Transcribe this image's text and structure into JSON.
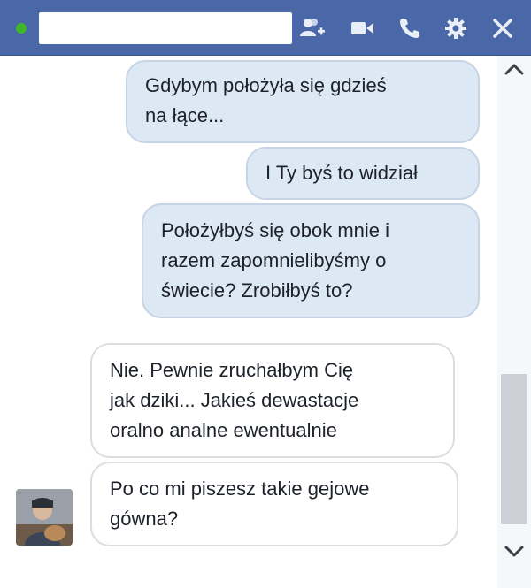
{
  "header": {
    "contact_name": "",
    "status": "online",
    "icons": [
      "add-friend-icon",
      "video-call-icon",
      "phone-icon",
      "gear-icon",
      "close-icon"
    ],
    "colors": {
      "bar": "#4a67a8",
      "status_dot": "#42b72a"
    }
  },
  "messages": [
    {
      "direction": "outgoing",
      "lines": [
        "Gdybym położyła się gdzieś",
        "na łące..."
      ]
    },
    {
      "direction": "outgoing",
      "lines": [
        "I Ty byś to widział"
      ]
    },
    {
      "direction": "outgoing",
      "lines": [
        "Położyłbyś się obok mnie i",
        "razem zapomnielibyśmy o",
        "świecie? Zrobiłbyś to?"
      ]
    },
    {
      "direction": "incoming",
      "lines": [
        "Nie. Pewnie zruchałbym Cię",
        "jak dziki... Jakieś dewastacje",
        "oralno analne ewentualnie"
      ]
    },
    {
      "direction": "incoming",
      "lines": [
        "Po co mi piszesz takie gejowe",
        "gówna?"
      ]
    }
  ],
  "colors": {
    "outgoing_bubble": "#dde8f5",
    "incoming_bubble": "#ffffff"
  }
}
